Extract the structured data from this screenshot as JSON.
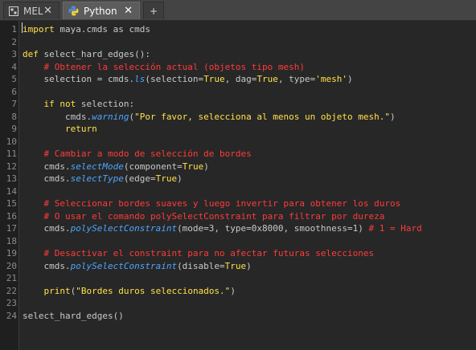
{
  "tabs": [
    {
      "label": "MEL",
      "icon": "mel-script-icon",
      "close": "✕"
    },
    {
      "label": "Python",
      "icon": "python-icon",
      "close": "✕",
      "active": true
    },
    {
      "label": "+"
    }
  ],
  "colors": {
    "keyword": "#ffe14a",
    "comment": "#ff3b3b",
    "function": "#4da6ff",
    "string": "#ffe14a",
    "text": "#c9c9c9"
  },
  "code_lines": [
    {
      "n": "1",
      "segs": [
        [
          "kw",
          "import"
        ],
        [
          "t",
          " maya.cmds as cmds"
        ]
      ]
    },
    {
      "n": "2",
      "segs": []
    },
    {
      "n": "3",
      "segs": [
        [
          "kw",
          "def"
        ],
        [
          "t",
          " select_hard_edges():"
        ]
      ]
    },
    {
      "n": "4",
      "segs": [
        [
          "t",
          "    "
        ],
        [
          "cm",
          "# Obtener la selección actual (objetos tipo mesh)"
        ]
      ]
    },
    {
      "n": "5",
      "segs": [
        [
          "t",
          "    selection = cmds."
        ],
        [
          "fn",
          "ls"
        ],
        [
          "t",
          "(selection="
        ],
        [
          "kw",
          "True"
        ],
        [
          "t",
          ", dag="
        ],
        [
          "kw",
          "True"
        ],
        [
          "t",
          ", type="
        ],
        [
          "str",
          "'mesh'"
        ],
        [
          "t",
          ")"
        ]
      ]
    },
    {
      "n": "6",
      "segs": []
    },
    {
      "n": "7",
      "segs": [
        [
          "t",
          "    "
        ],
        [
          "kw",
          "if not"
        ],
        [
          "t",
          " selection:"
        ]
      ]
    },
    {
      "n": "8",
      "segs": [
        [
          "t",
          "        cmds."
        ],
        [
          "fn",
          "warning"
        ],
        [
          "t",
          "("
        ],
        [
          "str",
          "\"Por favor, selecciona al menos un objeto mesh.\""
        ],
        [
          "t",
          ")"
        ]
      ]
    },
    {
      "n": "9",
      "segs": [
        [
          "t",
          "        "
        ],
        [
          "kw",
          "return"
        ]
      ]
    },
    {
      "n": "10",
      "segs": []
    },
    {
      "n": "11",
      "segs": [
        [
          "t",
          "    "
        ],
        [
          "cm",
          "# Cambiar a modo de selección de bordes"
        ]
      ]
    },
    {
      "n": "12",
      "segs": [
        [
          "t",
          "    cmds."
        ],
        [
          "fn",
          "selectMode"
        ],
        [
          "t",
          "(component="
        ],
        [
          "kw",
          "True"
        ],
        [
          "t",
          ")"
        ]
      ]
    },
    {
      "n": "13",
      "segs": [
        [
          "t",
          "    cmds."
        ],
        [
          "fn",
          "selectType"
        ],
        [
          "t",
          "(edge="
        ],
        [
          "kw",
          "True"
        ],
        [
          "t",
          ")"
        ]
      ]
    },
    {
      "n": "14",
      "segs": []
    },
    {
      "n": "15",
      "segs": [
        [
          "t",
          "    "
        ],
        [
          "cm",
          "# Seleccionar bordes suaves y luego invertir para obtener los duros"
        ]
      ]
    },
    {
      "n": "16",
      "segs": [
        [
          "t",
          "    "
        ],
        [
          "cm",
          "# O usar el comando polySelectConstraint para filtrar por dureza"
        ]
      ]
    },
    {
      "n": "17",
      "segs": [
        [
          "t",
          "    cmds."
        ],
        [
          "fn",
          "polySelectConstraint"
        ],
        [
          "t",
          "(mode=3, type=0x8000, smoothness=1) "
        ],
        [
          "cm",
          "# 1 = Hard"
        ]
      ]
    },
    {
      "n": "18",
      "segs": []
    },
    {
      "n": "19",
      "segs": [
        [
          "t",
          "    "
        ],
        [
          "cm",
          "# Desactivar el constraint para no afectar futuras selecciones"
        ]
      ]
    },
    {
      "n": "20",
      "segs": [
        [
          "t",
          "    cmds."
        ],
        [
          "fn",
          "polySelectConstraint"
        ],
        [
          "t",
          "(disable="
        ],
        [
          "kw",
          "True"
        ],
        [
          "t",
          ")"
        ]
      ]
    },
    {
      "n": "21",
      "segs": []
    },
    {
      "n": "22",
      "segs": [
        [
          "t",
          "    "
        ],
        [
          "kw",
          "print"
        ],
        [
          "t",
          "("
        ],
        [
          "str",
          "\"Bordes duros seleccionados.\""
        ],
        [
          "t",
          ")"
        ]
      ]
    },
    {
      "n": "23",
      "segs": []
    },
    {
      "n": "24",
      "segs": [
        [
          "t",
          "select_hard_edges()"
        ]
      ]
    }
  ]
}
